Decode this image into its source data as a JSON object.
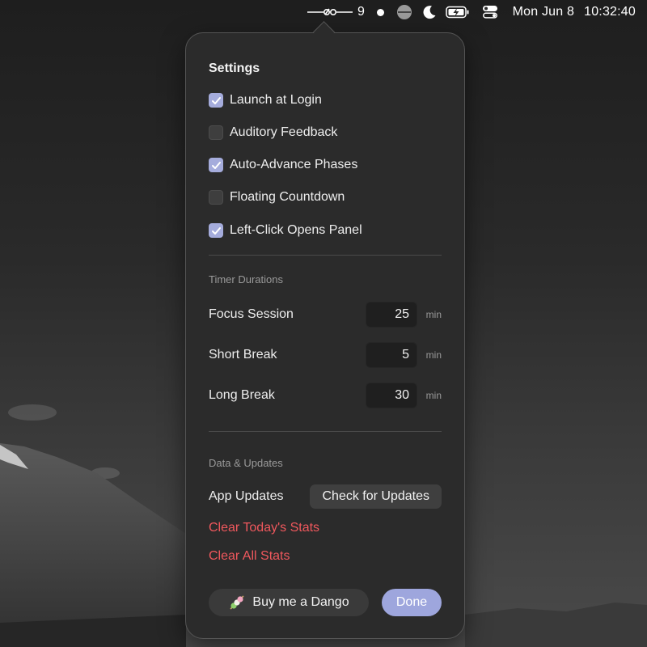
{
  "menubar": {
    "timer_count": "9",
    "date": "Mon Jun 8",
    "time": "10:32:40",
    "icons": [
      "pomodoro-status-icon",
      "dot-icon",
      "focus-icon",
      "moon-icon",
      "battery-charging-icon",
      "control-center-icon"
    ]
  },
  "panel": {
    "title": "Settings",
    "options": [
      {
        "label": "Launch at Login",
        "checked": true
      },
      {
        "label": "Auditory Feedback",
        "checked": false
      },
      {
        "label": "Auto-Advance Phases",
        "checked": true
      },
      {
        "label": "Floating Countdown",
        "checked": false
      },
      {
        "label": "Left-Click Opens Panel",
        "checked": true
      }
    ],
    "timer_section": "Timer Durations",
    "durations": [
      {
        "label": "Focus Session",
        "value": "25",
        "unit": "min"
      },
      {
        "label": "Short Break",
        "value": "5",
        "unit": "min"
      },
      {
        "label": "Long Break",
        "value": "30",
        "unit": "min"
      }
    ],
    "data_section": "Data & Updates",
    "app_updates_label": "App Updates",
    "check_updates_button": "Check for Updates",
    "clear_today": "Clear Today's Stats",
    "clear_all": "Clear All Stats",
    "dango_button": "Buy me a Dango",
    "done_button": "Done"
  },
  "colors": {
    "accent": "#9ea6dd",
    "checkbox_on": "#a5acdc",
    "danger": "#f0585d",
    "panel_bg": "#2b2b2b"
  }
}
